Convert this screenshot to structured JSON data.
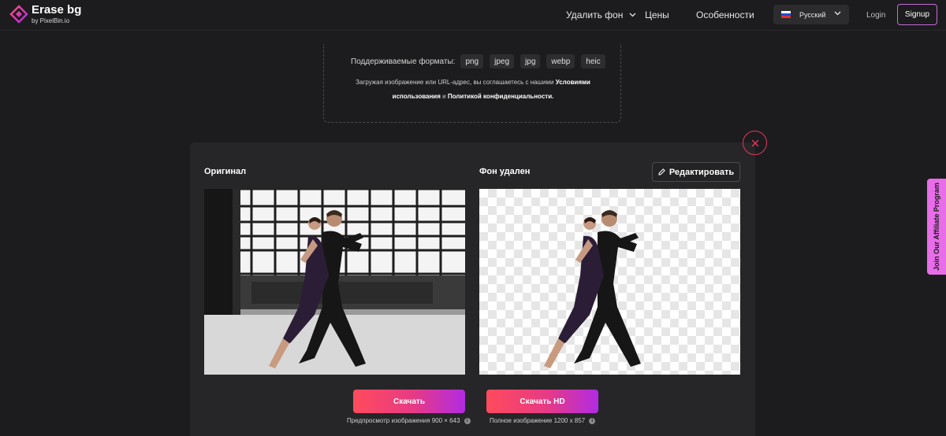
{
  "brand": {
    "title": "Erase bg",
    "subtitle": "by PixelBin.io"
  },
  "nav": {
    "remove_bg": "Удалить фон",
    "prices": "Цены",
    "features": "Особенности"
  },
  "language": {
    "selected": "Русский"
  },
  "auth": {
    "login": "Login",
    "signup": "Signup"
  },
  "upload": {
    "formats_label": "Поддерживаемые форматы:",
    "formats": [
      "png",
      "jpeg",
      "jpg",
      "webp",
      "heic"
    ],
    "terms_prefix": "Загружая изображение или URL-адрес, вы соглашаетесь с нашими",
    "terms_link": "Условиями использования",
    "terms_and": "и",
    "privacy_link": "Политикой конфиденциальности."
  },
  "result": {
    "original_label": "Оригинал",
    "removed_label": "Фон удален",
    "edit_label": "Редактировать",
    "download_label": "Скачать",
    "download_hd_label": "Скачать HD",
    "preview_note": "Предпросмотр изображения 900 × 643",
    "full_note": "Полное изображение 1200 x 857"
  },
  "affiliate": {
    "label": "Join Our Affiliate Program"
  },
  "colors": {
    "accent_start": "#ff4b5c",
    "accent_end": "#b12be3",
    "close_ring": "#e8375a",
    "affiliate_bg": "#e86de8"
  }
}
